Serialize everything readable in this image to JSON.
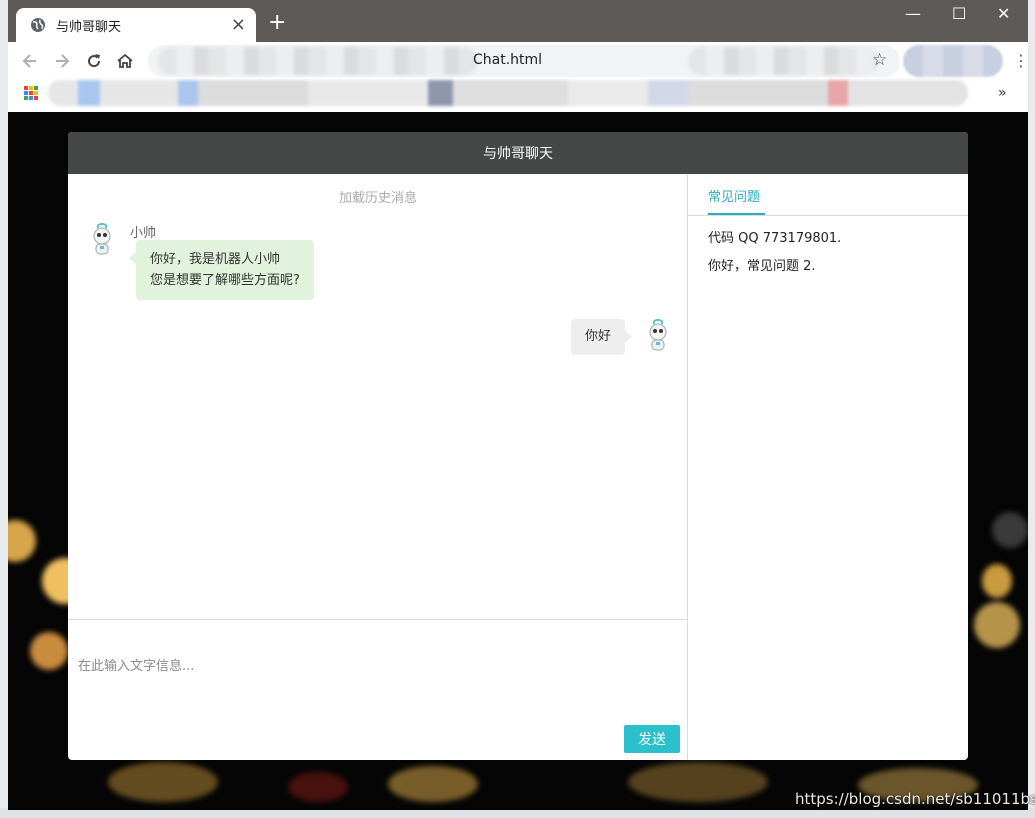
{
  "browser": {
    "tab_title": "与帅哥聊天",
    "url_visible": "Chat.html",
    "new_tab_symbol": "+",
    "window_controls": [
      "—",
      "☐",
      "✕"
    ]
  },
  "chat": {
    "header_title": "与帅哥聊天",
    "load_history": "加载历史消息",
    "messages": [
      {
        "from": "bot",
        "name": "小帅",
        "lines": [
          "你好，我是机器人小帅",
          "您是想要了解哪些方面呢?"
        ]
      },
      {
        "from": "user",
        "text": "你好"
      }
    ],
    "input_placeholder": "在此输入文字信息...",
    "send_label": "发送"
  },
  "faq": {
    "tab_label": "常见问题",
    "items": [
      "代码 QQ 773179801.",
      "你好，常见问题 2."
    ]
  },
  "watermark": "https://blog.csdn.net/sb11011bs",
  "colors": {
    "header_bg": "#464848",
    "accent": "#2bc1cc",
    "bot_bubble": "#e1f3dc",
    "user_bubble": "#eeeeee"
  },
  "icons": [
    "globe-icon",
    "close-icon",
    "back-icon",
    "forward-icon",
    "reload-icon",
    "home-icon",
    "star-icon",
    "apps-icon",
    "robot-avatar-icon"
  ]
}
